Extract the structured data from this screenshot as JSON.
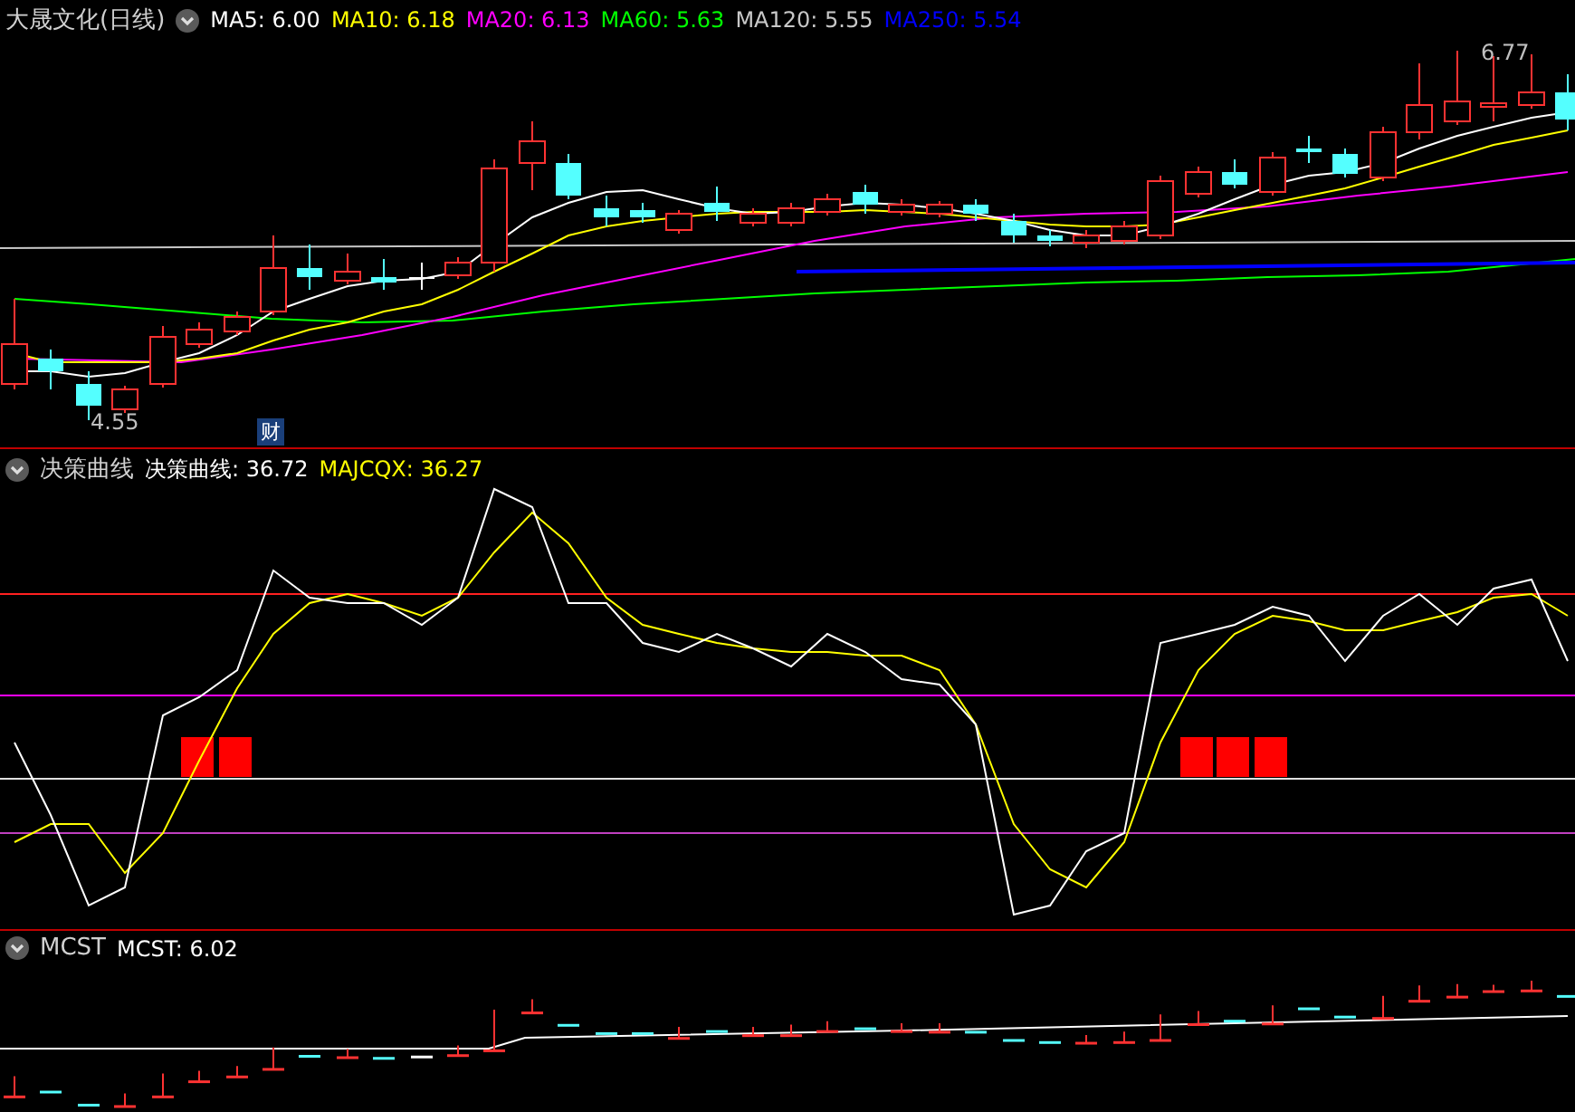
{
  "main_chart": {
    "title": "大晟文化(日线)",
    "indicators": [
      {
        "label": "MA5: 6.00",
        "color": "#ffffff"
      },
      {
        "label": "MA10: 6.18",
        "color": "#ffff00"
      },
      {
        "label": "MA20: 6.13",
        "color": "#ff00ff"
      },
      {
        "label": "MA60: 5.63",
        "color": "#00ff00"
      },
      {
        "label": "MA120: 5.55",
        "color": "#c8c8c8"
      },
      {
        "label": "MA250: 5.54",
        "color": "#0000ff"
      }
    ],
    "low_label": "4.55",
    "high_label": "6.77",
    "badge": "财"
  },
  "decision_panel": {
    "name": "决策曲线",
    "indicators": [
      {
        "label": "决策曲线: 36.72",
        "color": "#ffffff"
      },
      {
        "label": "MAJCQX: 36.27",
        "color": "#ffff00"
      }
    ]
  },
  "mcst_panel": {
    "name": "MCST",
    "indicators": [
      {
        "label": "MCST: 6.02",
        "color": "#ffffff"
      }
    ]
  }
}
